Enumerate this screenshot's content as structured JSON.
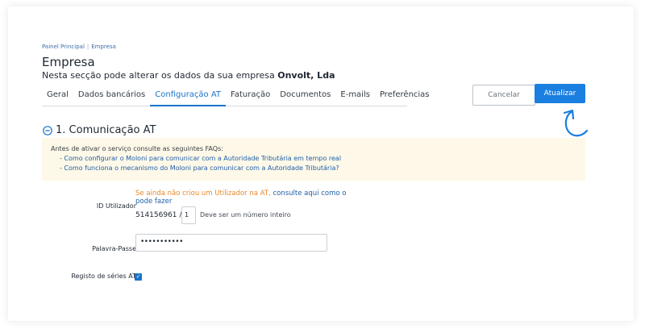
{
  "breadcrumb": {
    "home": "Painel Principal",
    "separator": "|",
    "current": "Empresa"
  },
  "page": {
    "title": "Empresa",
    "subtitle_prefix": "Nesta secção pode alterar os dados da sua empresa ",
    "company": "Onvolt, Lda"
  },
  "tabs": [
    "Geral",
    "Dados bancários",
    "Configuração AT",
    "Faturação",
    "Documentos",
    "E-mails",
    "Preferências"
  ],
  "active_tab": "Configuração AT",
  "buttons": {
    "cancel": "Cancelar",
    "update": "Atualizar"
  },
  "section": {
    "title": "1. Comunicação AT",
    "icon": "minus-circle-icon"
  },
  "info": {
    "intro": "Antes de ativar o serviço consulte as seguintes FAQs:",
    "faq1": "- Como configurar o Moloni para comunicar com a Autoridade Tributária em tempo real",
    "faq2": "- Como funciona o mecanismo do Moloni para comunicar com a Autoridade Tributária?"
  },
  "form": {
    "user_label": "ID Utilizador",
    "user_warning": "Se ainda não criou um Utilizador na AT,",
    "user_link_1": "consulte aqui como o",
    "user_link_2": "pode fazer",
    "nif": "514156961 /",
    "user_suffix": "1",
    "user_hint": "Deve ser um número inteiro",
    "password_label": "Palavra-Passe",
    "password_value": "•••••••••••",
    "series_label": "Registo de séries AT",
    "series_checked": true
  },
  "colors": {
    "accent": "#1a7fe0",
    "info_bg": "#fef8e8",
    "warning": "#e8892c",
    "link": "#1f5fa8"
  }
}
